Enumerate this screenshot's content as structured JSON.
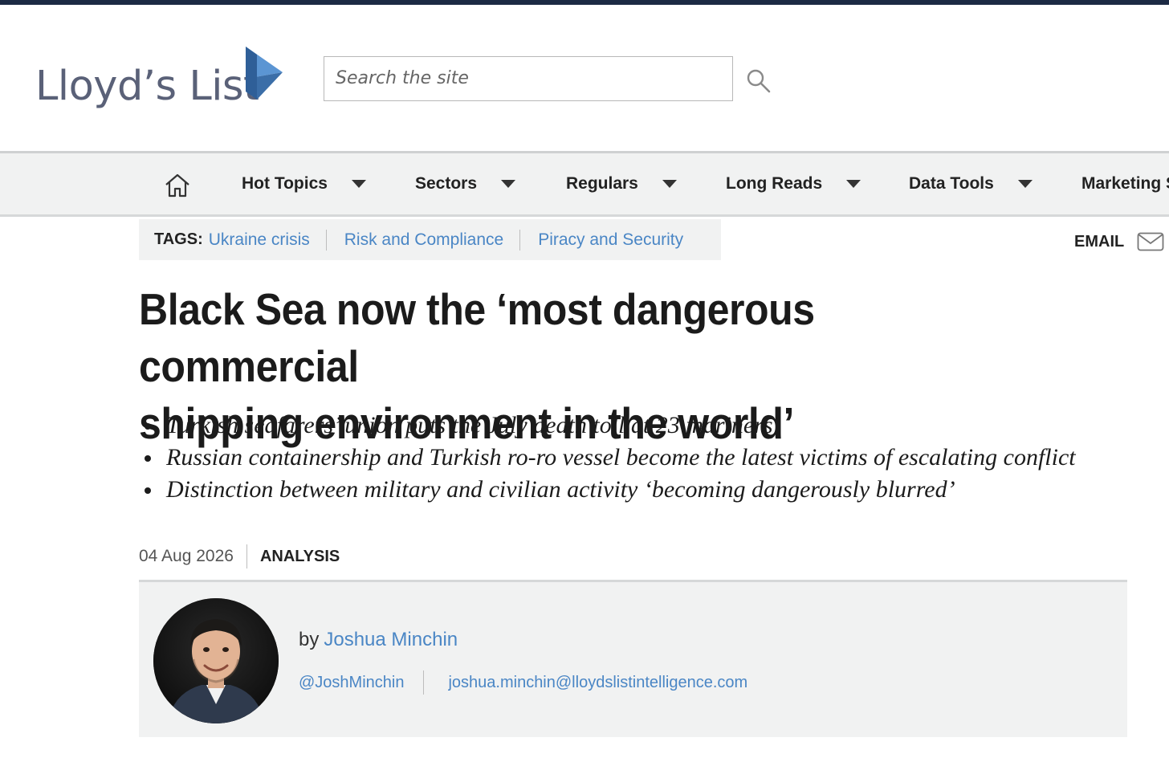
{
  "brand": {
    "name": "Lloyd’s List",
    "color_text": "#5a6178",
    "color_mark_dark": "#3b6ea8",
    "color_mark_light": "#5b95d3"
  },
  "search": {
    "placeholder": "Search the site",
    "value": "",
    "icon": "search-icon"
  },
  "nav": {
    "home_icon": "home-icon",
    "items": [
      {
        "label": "Hot Topics"
      },
      {
        "label": "Sectors"
      },
      {
        "label": "Regulars"
      },
      {
        "label": "Long Reads"
      },
      {
        "label": "Data Tools"
      },
      {
        "label": "Marketing S"
      }
    ]
  },
  "tags": {
    "label": "TAGS:",
    "items": [
      "Ukraine crisis",
      "Risk and Compliance",
      "Piracy and Security"
    ]
  },
  "share": {
    "email_label": "EMAIL",
    "icon": "envelope-icon"
  },
  "article": {
    "headline_line1": "Black Sea now the ‘most dangerous commercial",
    "headline_line2": "shipping environment in the world’",
    "bullets": [
      "Turkish seafarers’ union puts the July death toll at 23 mariners",
      "Russian containership and Turkish ro-ro vessel become the latest victims of escalating conflict",
      "Distinction between military and civilian activity ‘becoming dangerously blurred’"
    ],
    "date": "04 Aug 2026",
    "type": "ANALYSIS"
  },
  "author": {
    "by": "by",
    "name": "Joshua Minchin",
    "twitter": "@JoshMinchin",
    "email": "joshua.minchin@lloydslistintelligence.com"
  },
  "colors": {
    "link": "#4a86c5",
    "topbar": "#1c2a44",
    "panel": "#f1f2f2"
  }
}
